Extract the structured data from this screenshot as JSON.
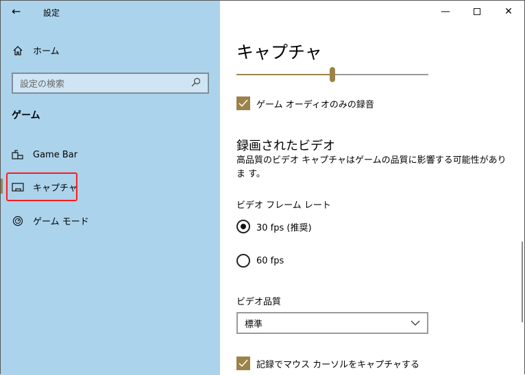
{
  "window": {
    "title": "設定"
  },
  "sidebar": {
    "home": "ホーム",
    "search_placeholder": "設定の検索",
    "section": "ゲーム",
    "items": [
      {
        "label": "Game Bar"
      },
      {
        "label": "キャプチャ"
      },
      {
        "label": "ゲーム モード"
      }
    ]
  },
  "main": {
    "title": "キャプチャ",
    "volume_percent": 50,
    "audio_only_label": "ゲーム オーディオのみの録音",
    "recorded_heading": "録画されたビデオ",
    "recorded_desc": "高品質のビデオ キャプチャはゲームの品質に影響する可能性がありま す。",
    "framerate_label": "ビデオ フレーム レート",
    "fps30": "30 fps (推奨)",
    "fps60": "60 fps",
    "quality_label": "ビデオ品質",
    "quality_value": "標準",
    "cursor_label": "記録でマウス カーソルをキャプチャする"
  },
  "colors": {
    "accent": "#9b8348",
    "highlight": "#ff0000"
  }
}
